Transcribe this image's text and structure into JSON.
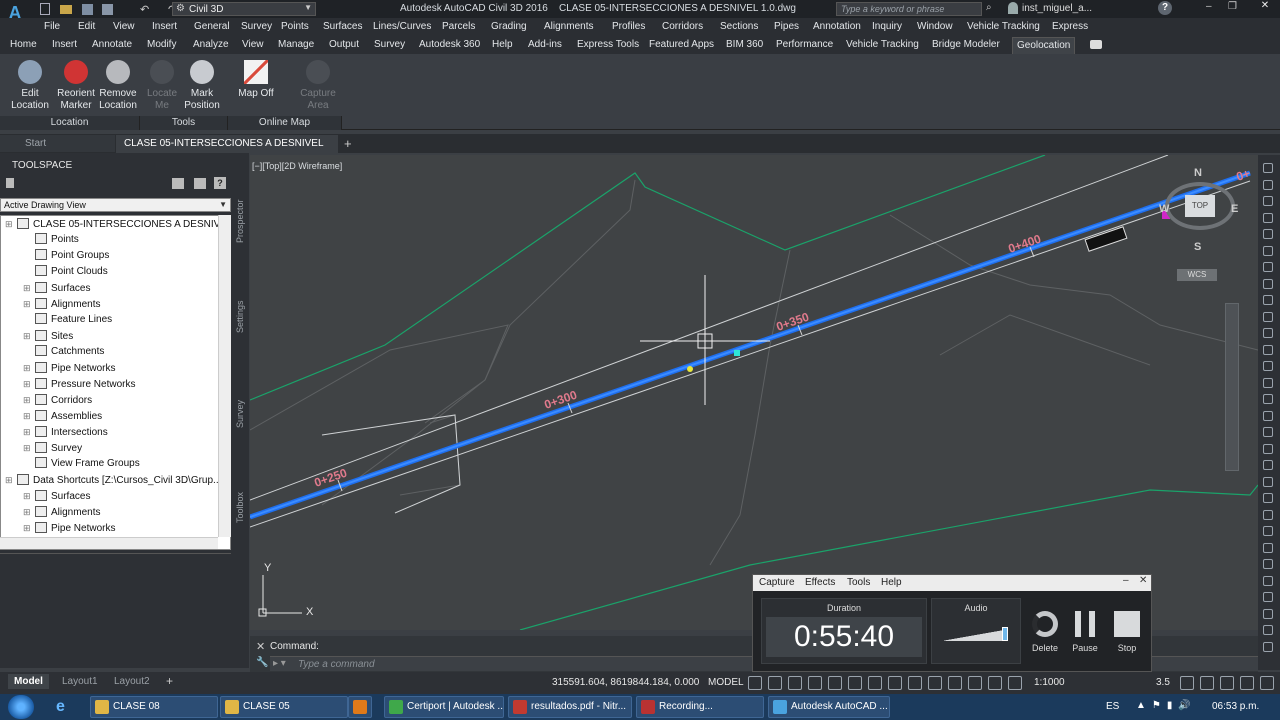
{
  "title_bar": {
    "workspace": "Civil 3D",
    "title": "Autodesk AutoCAD Civil 3D 2016    CLASE 05-INTERSECCIONES A DESNIVEL 1.0.dwg",
    "search_placeholder": "Type a keyword or phrase",
    "user": "inst_miguel_a..."
  },
  "menu": [
    "File",
    "Edit",
    "View",
    "Insert",
    "General",
    "Survey",
    "Points",
    "Surfaces",
    "Lines/Curves",
    "Parcels",
    "Grading",
    "Alignments",
    "Profiles",
    "Corridors",
    "Sections",
    "Pipes",
    "Annotation",
    "Inquiry",
    "Window",
    "Vehicle Tracking",
    "Express"
  ],
  "ribbon_tabs": [
    "Home",
    "Insert",
    "Annotate",
    "Modify",
    "Analyze",
    "View",
    "Manage",
    "Output",
    "Survey",
    "Autodesk 360",
    "Help",
    "Add-ins",
    "Express Tools",
    "Featured Apps",
    "BIM 360",
    "Performance",
    "Vehicle Tracking",
    "Bridge Modeler",
    "Geolocation"
  ],
  "ribbon": {
    "buttons": [
      {
        "line1": "Edit",
        "line2": "Location",
        "icon": "globe-edit-icon"
      },
      {
        "line1": "Reorient",
        "line2": "Marker",
        "icon": "marker-icon"
      },
      {
        "line1": "Remove",
        "line2": "Location",
        "icon": "globe-remove-icon"
      },
      {
        "line1": "Locate",
        "line2": "Me",
        "icon": "locate-icon"
      },
      {
        "line1": "Mark",
        "line2": "Position",
        "icon": "pin-icon"
      },
      {
        "line1": "Map Off",
        "line2": "",
        "icon": "map-icon"
      },
      {
        "line1": "Capture",
        "line2": "Area",
        "icon": "capture-icon"
      }
    ],
    "panels": [
      "Location",
      "Tools",
      "Online Map"
    ]
  },
  "doc_tabs": {
    "start": "Start",
    "active": "CLASE 05-INTERSECCIONES A DESNIVEL 1.0*",
    "plus": "+"
  },
  "toolspace": {
    "title": "TOOLSPACE",
    "dropdown": "Active Drawing View",
    "root": "CLASE 05-INTERSECCIONES A DESNIV...",
    "items": [
      "Points",
      "Point Groups",
      "Point Clouds",
      "Surfaces",
      "Alignments",
      "Feature Lines",
      "Sites",
      "Catchments",
      "Pipe Networks",
      "Pressure Networks",
      "Corridors",
      "Assemblies",
      "Intersections",
      "Survey",
      "View Frame Groups"
    ],
    "shortcuts_root": "Data Shortcuts [Z:\\Cursos_Civil 3D\\Grup...",
    "shortcut_items": [
      "Surfaces",
      "Alignments",
      "Pipe Networks"
    ],
    "side_tabs": [
      "Prospector",
      "Settings",
      "Survey",
      "Toolbox"
    ]
  },
  "viewport": {
    "label": "[−][Top][2D Wireframe]",
    "stations": [
      "0+250",
      "0+300",
      "0+350",
      "0+400",
      "0+"
    ],
    "compass": {
      "n": "N",
      "s": "S",
      "e": "E",
      "w": "W",
      "top": "TOP"
    },
    "wcs": "WCS",
    "axis_x": "X",
    "axis_y": "Y"
  },
  "command": {
    "history": "Command:",
    "placeholder": "Type a command"
  },
  "recorder": {
    "menu": [
      "Capture",
      "Effects",
      "Tools",
      "Help"
    ],
    "duration_label": "Duration",
    "duration": "0:55:40",
    "audio_label": "Audio",
    "delete": "Delete",
    "pause": "Pause",
    "stop": "Stop"
  },
  "status": {
    "tabs": [
      "Model",
      "Layout1",
      "Layout2"
    ],
    "coords": "315591.604, 8619844.184, 0.000",
    "model": "MODEL",
    "scale": "1:1000",
    "value": "3.5"
  },
  "taskbar": {
    "items": [
      "CLASE 08",
      "CLASE 05",
      "",
      "Certiport | Autodesk ...",
      "resultados.pdf - Nitr...",
      "Recording...",
      "Autodesk AutoCAD ..."
    ],
    "lang": "ES",
    "time": "06:53 p.m."
  }
}
